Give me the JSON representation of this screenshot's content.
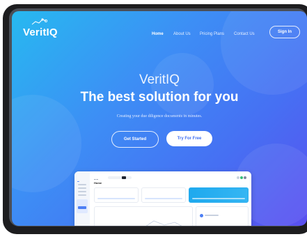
{
  "header": {
    "logo_text": "VeritIQ",
    "nav": [
      {
        "label": "Home",
        "active": true
      },
      {
        "label": "About Us",
        "active": false
      },
      {
        "label": "Pricing Plans",
        "active": false
      },
      {
        "label": "Contact Us",
        "active": false
      }
    ],
    "signin_label": "Sign In"
  },
  "hero": {
    "brand": "VeritIQ",
    "headline": "The best solution for you",
    "subtitle": "Creating your due diligence documents in minutes.",
    "primary_button": "Get Started",
    "secondary_button": "Try For Free"
  },
  "dashboard_preview": {
    "page_title": "Home"
  },
  "colors": {
    "gradient_start": "#27b9f0",
    "gradient_end": "#5a4ff0",
    "accent": "#3f6ff2"
  }
}
